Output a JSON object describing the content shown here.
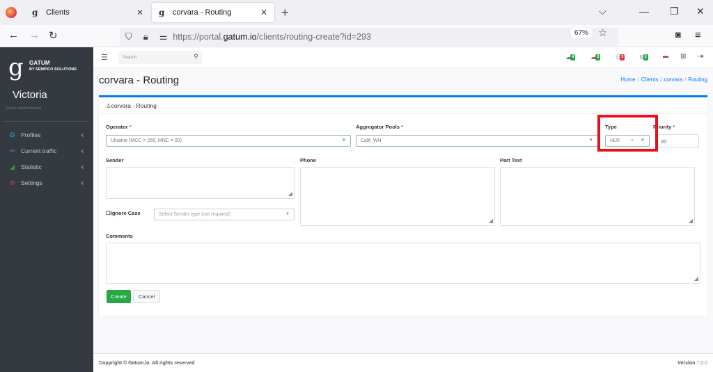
{
  "browser": {
    "tabs": [
      {
        "label": "Clients",
        "active": false
      },
      {
        "label": "corvara - Routing",
        "active": true
      }
    ],
    "url_prefix": "https://portal.",
    "url_domain": "gatum.io",
    "url_path": "/clients/routing-create?id=293",
    "zoom_level": "67%"
  },
  "sidebar": {
    "brand": "GATUM",
    "brand_sub": "BY SEMPICO SOLUTIONS",
    "user_name": "Victoria",
    "user_role": "[Super administrator]",
    "items": [
      {
        "label": "Profiles",
        "icon": "profiles-icon",
        "color": "#17a2b8"
      },
      {
        "label": "Current traffic",
        "icon": "traffic-icon",
        "color": "#3c8dbc"
      },
      {
        "label": "Statistic",
        "icon": "chart-icon",
        "color": "#28a745"
      },
      {
        "label": "Settings",
        "icon": "gears-icon",
        "color": "#dc3545"
      }
    ]
  },
  "topnav": {
    "search_placeholder": "Search",
    "badges": [
      {
        "icon": "messages-icon",
        "count": "4",
        "color": "#28a745"
      },
      {
        "icon": "alert-messages-icon",
        "count": "3",
        "color": "#28a745"
      },
      {
        "icon": "users-icon",
        "count": "3",
        "color": "#dc3545"
      },
      {
        "icon": "plug-icon",
        "count": "2",
        "color": "#28a745"
      }
    ]
  },
  "page": {
    "title": "corvara - Routing",
    "breadcrumb": [
      "Home",
      "Clients",
      "corvara",
      "Routing"
    ]
  },
  "form": {
    "header": "corvara - Routing",
    "operator_label": "Operator",
    "operator_value": "Ukraine (MCC = 255, MNC = 00)",
    "aggregator_label": "Aggregator Pools",
    "aggregator_value": "Calif_WH",
    "type_label": "Type",
    "type_value": "HLR",
    "priority_label": "Priority",
    "priority_value": "20",
    "sender_label": "Sender",
    "phone_label": "Phone",
    "part_text_label": "Part Text",
    "ignore_case_label": "Ignore Case",
    "sender_type_placeholder": "Select Sender type (not required)",
    "comments_label": "Comments",
    "create_label": "Create",
    "cancel_label": "Cancel"
  },
  "footer": {
    "copyright": "Copyright © Gatum.io. All rights reserved",
    "version_label": "Version",
    "version_value": "7.0.0"
  }
}
